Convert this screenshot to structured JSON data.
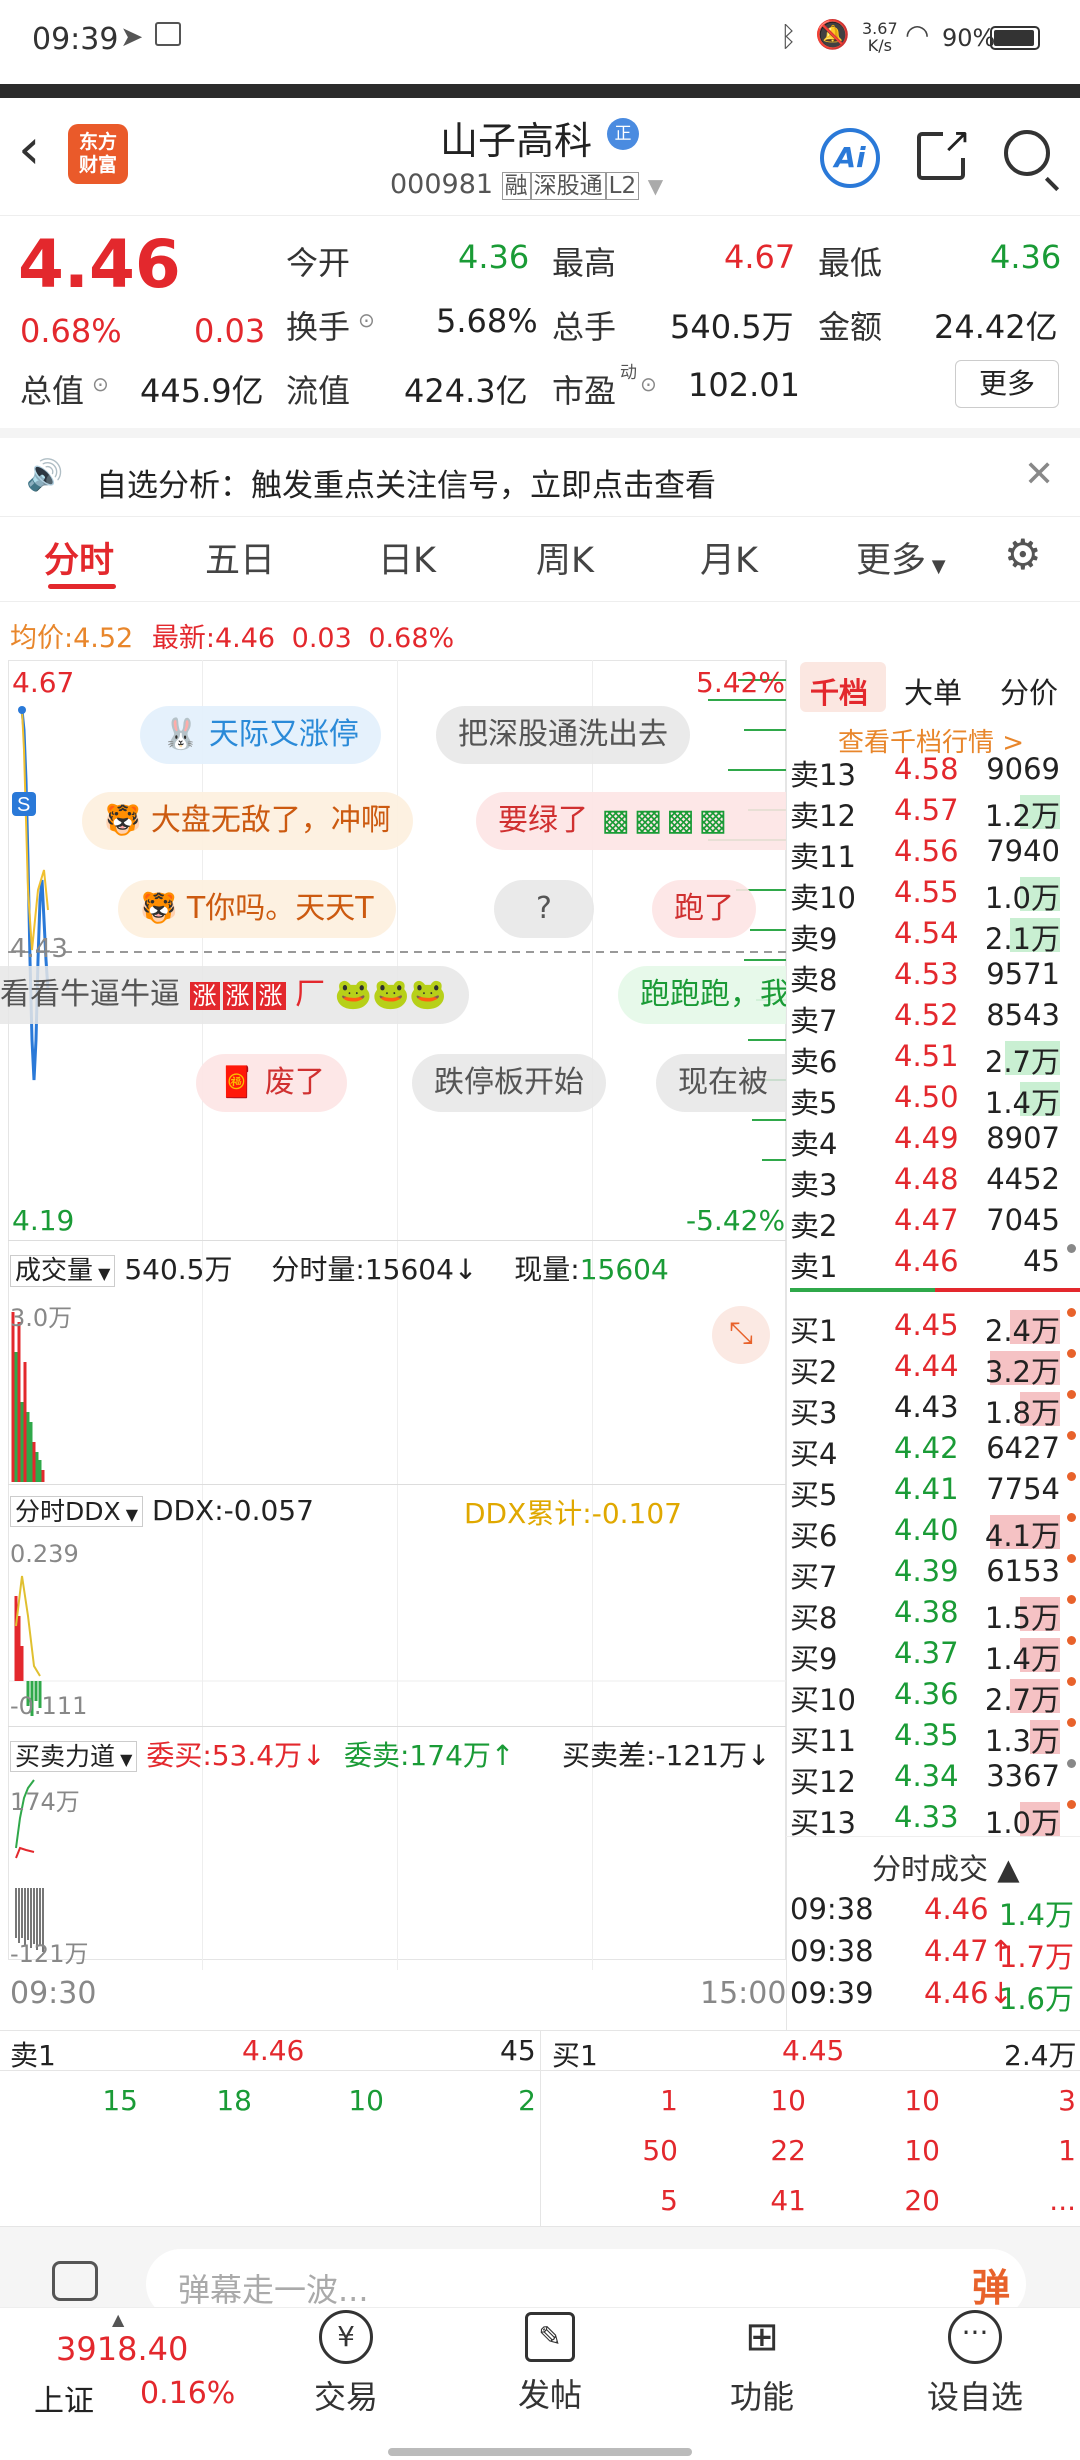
{
  "status": {
    "time": "09:39",
    "net_speed_top": "3.67",
    "net_speed_unit": "K/s",
    "battery": "90%"
  },
  "header": {
    "brand_line1": "东方",
    "brand_line2": "财富",
    "name": "山子高科",
    "name_badge": "正",
    "code": "000981",
    "tag1": "融",
    "tag2": "深股通",
    "tag3": "L2",
    "ai": "Ai"
  },
  "quote": {
    "price": "4.46",
    "change_pct": "0.68%",
    "change": "0.03",
    "open_label": "今开",
    "open": "4.36",
    "high_label": "最高",
    "high": "4.67",
    "low_label": "最低",
    "low": "4.36",
    "turnover_label": "换手",
    "turnover": "5.68%",
    "volume_label": "总手",
    "volume": "540.5万",
    "amount_label": "金额",
    "amount": "24.42亿",
    "mktcap_label": "总值",
    "mktcap": "445.9亿",
    "float_label": "流值",
    "float": "424.3亿",
    "pe_label": "市盈",
    "pe_sup": "动",
    "pe": "102.01",
    "more": "更多"
  },
  "notice": {
    "text": "自选分析：触发重点关注信号，立即点击查看"
  },
  "tabs": {
    "items": [
      "分时",
      "五日",
      "日K",
      "周K",
      "月K",
      "更多"
    ]
  },
  "info_line": {
    "avg_label": "均价:",
    "avg": "4.52",
    "latest_label": "最新:",
    "latest": "4.46",
    "chg": "0.03",
    "pct": "0.68%"
  },
  "chart": {
    "high": "4.67",
    "high_pct": "5.42%",
    "mid": "4.43",
    "low": "4.19",
    "low_pct": "-5.42%",
    "time_start": "09:30",
    "time_end": "15:00"
  },
  "danmaku": {
    "d1": "天际又涨停",
    "d2": "把深股通洗出去",
    "d3": "大盘无敌了，冲啊",
    "d4": "要绿了",
    "d5": "T你吗。天天T",
    "d6": "?",
    "d7": "跑了",
    "d8": "看看牛逼牛逼",
    "d8_tag": "涨",
    "d9": "跑跑跑，我",
    "d10": "废了",
    "d11": "跌停板开始",
    "d12": "现在被"
  },
  "volume": {
    "label": "成交量",
    "total": "540.5万",
    "min_label": "分时量:",
    "min_val": "15604",
    "cur_label": "现量:",
    "cur_val": "15604",
    "axis_top": "3.0万"
  },
  "ddx": {
    "label": "分时DDX",
    "ddx": "DDX:-0.057",
    "ddx_sum": "DDX累计:-0.107",
    "axis_top": "0.239",
    "axis_bottom": "-0.111"
  },
  "force": {
    "label": "买卖力道",
    "buy": "委买:53.4万",
    "sell": "委卖:174万",
    "diff": "买卖差:-121万",
    "axis_top": "174万",
    "axis_bottom": "-121万"
  },
  "orderbook": {
    "tabs": [
      "千档",
      "大单",
      "分价"
    ],
    "link": "查看千档行情 >",
    "asks": [
      {
        "label": "卖13",
        "price": "4.58",
        "vol": "9069"
      },
      {
        "label": "卖12",
        "price": "4.57",
        "vol": "1.2万"
      },
      {
        "label": "卖11",
        "price": "4.56",
        "vol": "7940"
      },
      {
        "label": "卖10",
        "price": "4.55",
        "vol": "1.0万"
      },
      {
        "label": "卖9",
        "price": "4.54",
        "vol": "2.1万"
      },
      {
        "label": "卖8",
        "price": "4.53",
        "vol": "9571"
      },
      {
        "label": "卖7",
        "price": "4.52",
        "vol": "8543"
      },
      {
        "label": "卖6",
        "price": "4.51",
        "vol": "2.7万"
      },
      {
        "label": "卖5",
        "price": "4.50",
        "vol": "1.4万"
      },
      {
        "label": "卖4",
        "price": "4.49",
        "vol": "8907"
      },
      {
        "label": "卖3",
        "price": "4.48",
        "vol": "4452"
      },
      {
        "label": "卖2",
        "price": "4.47",
        "vol": "7045"
      },
      {
        "label": "卖1",
        "price": "4.46",
        "vol": "45"
      }
    ],
    "bids": [
      {
        "label": "买1",
        "price": "4.45",
        "vol": "2.4万"
      },
      {
        "label": "买2",
        "price": "4.44",
        "vol": "3.2万"
      },
      {
        "label": "买3",
        "price": "4.43",
        "vol": "1.8万"
      },
      {
        "label": "买4",
        "price": "4.42",
        "vol": "6427"
      },
      {
        "label": "买5",
        "price": "4.41",
        "vol": "7754"
      },
      {
        "label": "买6",
        "price": "4.40",
        "vol": "4.1万"
      },
      {
        "label": "买7",
        "price": "4.39",
        "vol": "6153"
      },
      {
        "label": "买8",
        "price": "4.38",
        "vol": "1.5万"
      },
      {
        "label": "买9",
        "price": "4.37",
        "vol": "1.4万"
      },
      {
        "label": "买10",
        "price": "4.36",
        "vol": "2.7万"
      },
      {
        "label": "买11",
        "price": "4.35",
        "vol": "1.3万"
      },
      {
        "label": "买12",
        "price": "4.34",
        "vol": "3367"
      },
      {
        "label": "买13",
        "price": "4.33",
        "vol": "1.0万"
      }
    ],
    "trades_label": "分时成交",
    "trades": [
      {
        "time": "09:38",
        "price": "4.46",
        "vol": "1.4万"
      },
      {
        "time": "09:38",
        "price": "4.47↑",
        "vol": "1.7万"
      },
      {
        "time": "09:39",
        "price": "4.46↓",
        "vol": "1.6万"
      }
    ]
  },
  "queue": {
    "sell_label": "卖1",
    "sell_price": "4.46",
    "sell_vol": "45",
    "buy_label": "买1",
    "buy_price": "4.45",
    "buy_vol": "2.4万",
    "sell_queue": [
      "15",
      "18",
      "10",
      "2"
    ],
    "buy_queue_r1": [
      "1",
      "10",
      "10",
      "3"
    ],
    "buy_queue_r2": [
      "50",
      "22",
      "10",
      "1"
    ],
    "buy_queue_r3": [
      "5",
      "41",
      "20",
      "..."
    ]
  },
  "comment": {
    "placeholder": "弹幕走一波...",
    "danmaku_btn": "弹"
  },
  "bottom_nav": {
    "index_val": "3918.40",
    "index_name": "上证",
    "index_pct": "0.16%",
    "trade": "交易",
    "post": "发帖",
    "func": "功能",
    "watch": "设自选"
  }
}
